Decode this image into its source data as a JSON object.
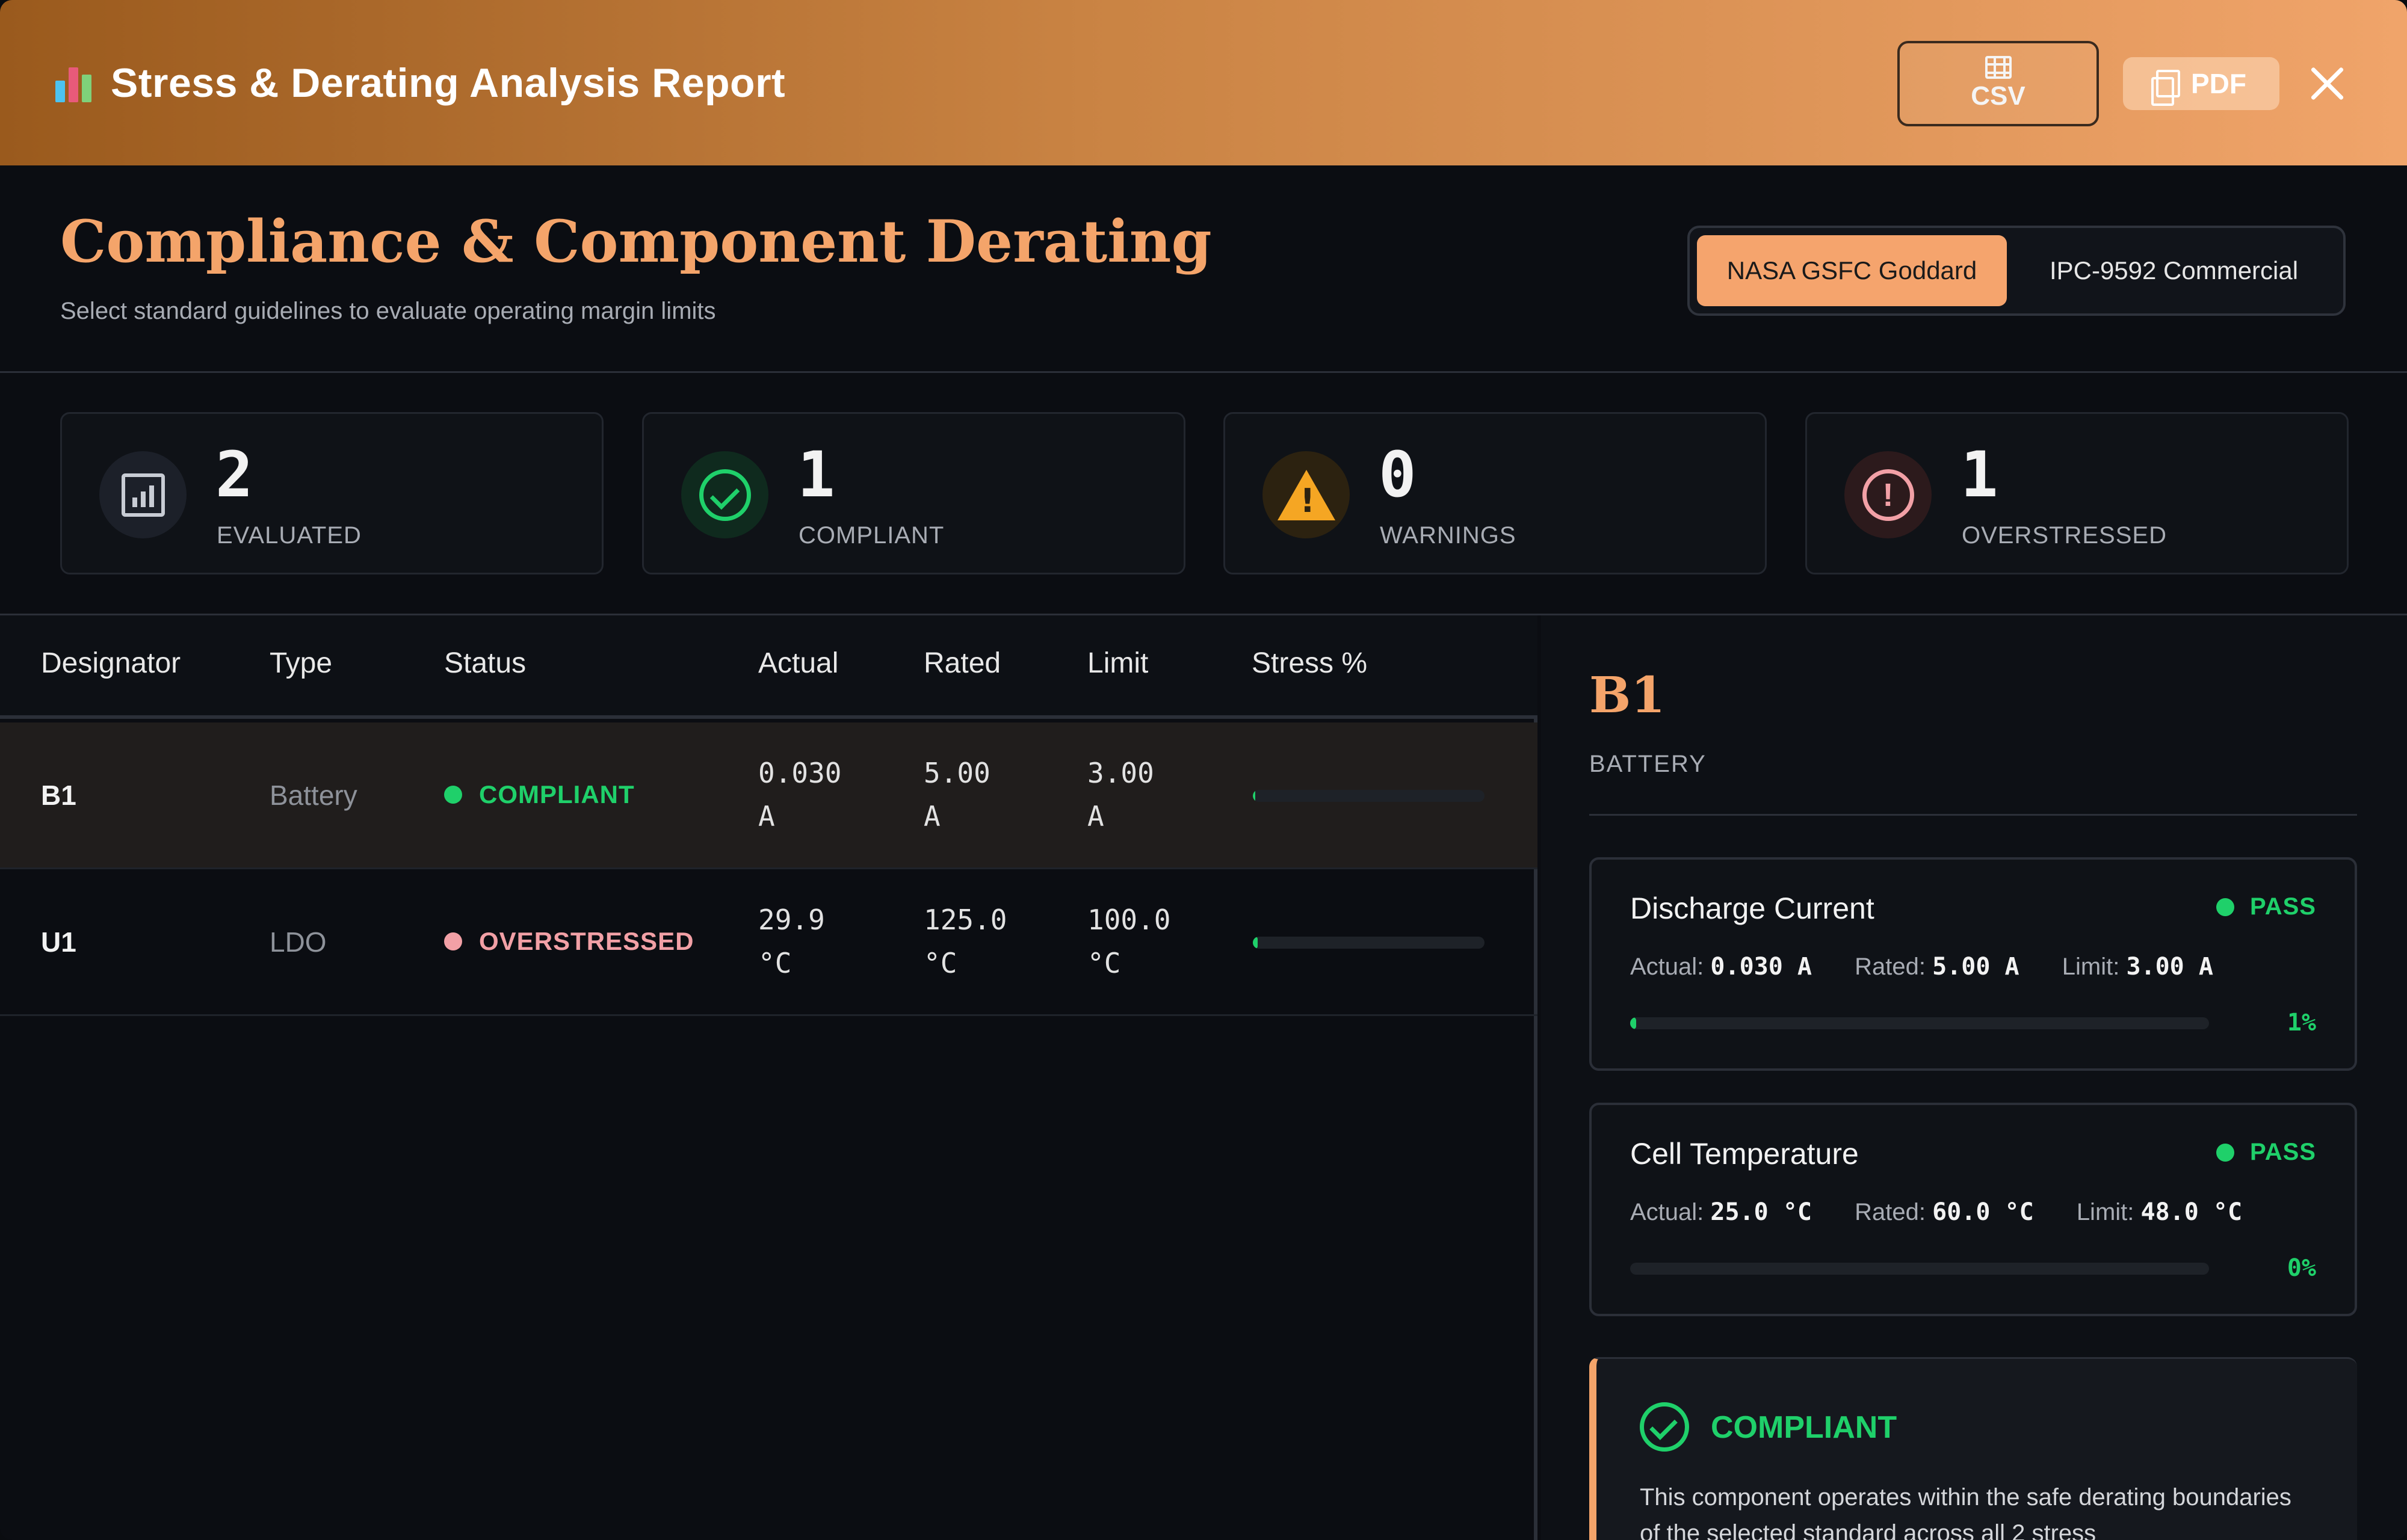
{
  "header": {
    "title": "Stress & Derating Analysis Report",
    "csv_label": "CSV",
    "pdf_label": "PDF",
    "icons": {
      "app": "bar-chart-icon",
      "csv": "grid-icon",
      "pdf": "pdf-icon",
      "close": "close-icon"
    }
  },
  "section": {
    "title": "Compliance & Component Derating",
    "subtitle": "Select standard guidelines to evaluate operating margin limits",
    "standards": [
      {
        "label": "NASA GSFC Goddard",
        "active": true
      },
      {
        "label": "IPC-9592 Commercial",
        "active": false
      }
    ]
  },
  "kpis": [
    {
      "value": "2",
      "label": "EVALUATED",
      "icon": "chart-icon"
    },
    {
      "value": "1",
      "label": "COMPLIANT",
      "icon": "check-circle-icon"
    },
    {
      "value": "0",
      "label": "WARNINGS",
      "icon": "warning-icon"
    },
    {
      "value": "1",
      "label": "OVERSTRESSED",
      "icon": "alert-circle-icon"
    }
  ],
  "table": {
    "columns": [
      "Designator",
      "Type",
      "Status",
      "Actual",
      "Rated",
      "Limit",
      "Stress %"
    ],
    "rows": [
      {
        "designator": "B1",
        "type": "Battery",
        "status": "COMPLIANT",
        "actual_num": "0.030",
        "actual_unit": "A",
        "rated_num": "5.00",
        "rated_unit": "A",
        "limit_num": "3.00",
        "limit_unit": "A",
        "stress": 1
      },
      {
        "designator": "U1",
        "type": "LDO",
        "status": "OVERSTRESSED",
        "actual_num": "29.9",
        "actual_unit": "°C",
        "rated_num": "125.0",
        "rated_unit": "°C",
        "limit_num": "100.0",
        "limit_unit": "°C",
        "stress": 2
      }
    ]
  },
  "detail": {
    "designator": "B1",
    "type": "BATTERY",
    "params": [
      {
        "name": "Discharge Current",
        "status": "PASS",
        "actual_label": "Actual:",
        "actual": "0.030 A",
        "rated_label": "Rated:",
        "rated": "5.00 A",
        "limit_label": "Limit:",
        "limit": "3.00 A",
        "pct": "1%",
        "fill": 1
      },
      {
        "name": "Cell Temperature",
        "status": "PASS",
        "actual_label": "Actual:",
        "actual": "25.0 °C",
        "rated_label": "Rated:",
        "rated": "60.0 °C",
        "limit_label": "Limit:",
        "limit": "48.0 °C",
        "pct": "0%",
        "fill": 0
      }
    ],
    "verdict": {
      "title": "COMPLIANT",
      "text": "This component operates within the safe derating boundaries of the selected standard across all 2 stress"
    }
  },
  "colors": {
    "accent": "#f4a46a",
    "ok": "#1fd06a",
    "warn": "#f5a623",
    "bad": "#f2a0a6"
  }
}
